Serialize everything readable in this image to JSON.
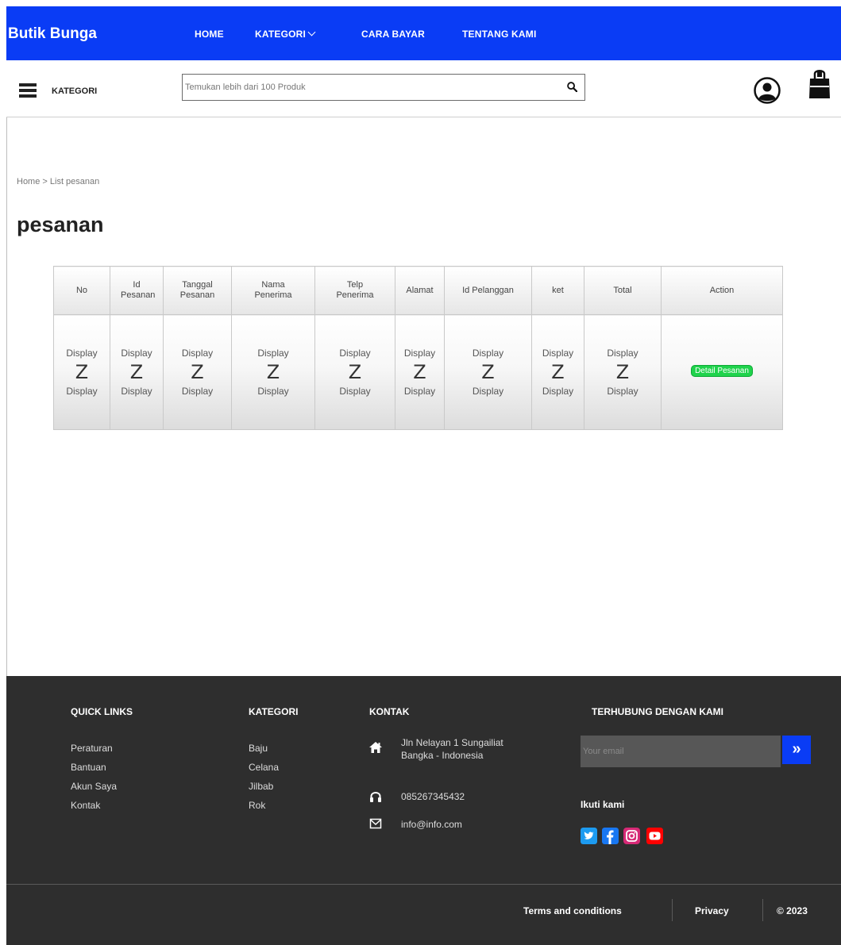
{
  "header": {
    "brand": "Butik Bunga",
    "nav": [
      "HOME",
      "KATEGORI",
      "CARA BAYAR",
      "TENTANG KAMI"
    ]
  },
  "searchbar": {
    "category_label": "KATEGORI",
    "search_placeholder": "Temukan lebih dari 100 Produk"
  },
  "breadcrumb": "Home > List pesanan",
  "page_title": "pesanan",
  "table": {
    "headers": [
      "No",
      "Id Pesanan",
      "Tanggal Pesanan",
      "Nama Penerima",
      "Telp Penerima",
      "Alamat",
      "Id Pelanggan",
      "ket",
      "Total",
      "Action"
    ],
    "cell_top": "Display",
    "cell_mid": "Z",
    "cell_bottom": "Display",
    "action_label": "Detail Pesanan"
  },
  "footer": {
    "quick_links": {
      "title": "QUICK LINKS",
      "items": [
        "Peraturan",
        "Bantuan",
        "Akun Saya",
        "Kontak"
      ]
    },
    "kategori": {
      "title": "KATEGORI",
      "items": [
        "Baju",
        "Celana",
        "Jilbab",
        "Rok"
      ]
    },
    "kontak": {
      "title": "KONTAK",
      "address_line1": "Jln Nelayan 1 Sungailiat",
      "address_line2": "Bangka - Indonesia",
      "phone": "085267345432",
      "email": "info@info.com"
    },
    "connect": {
      "title": "TERHUBUNG DENGAN KAMI",
      "email_placeholder": "Your email",
      "follow_label": "Ikuti kami",
      "socials": [
        "twitter-icon",
        "facebook-icon",
        "instagram-icon",
        "youtube-icon"
      ]
    },
    "bottom": {
      "terms": "Terms and conditions",
      "privacy": "Privacy",
      "copyright": "© 2023"
    }
  },
  "colors": {
    "primary_blue": "#0a3cf5",
    "footer_bg": "#2e2e2e",
    "action_green": "#1fd34c"
  }
}
